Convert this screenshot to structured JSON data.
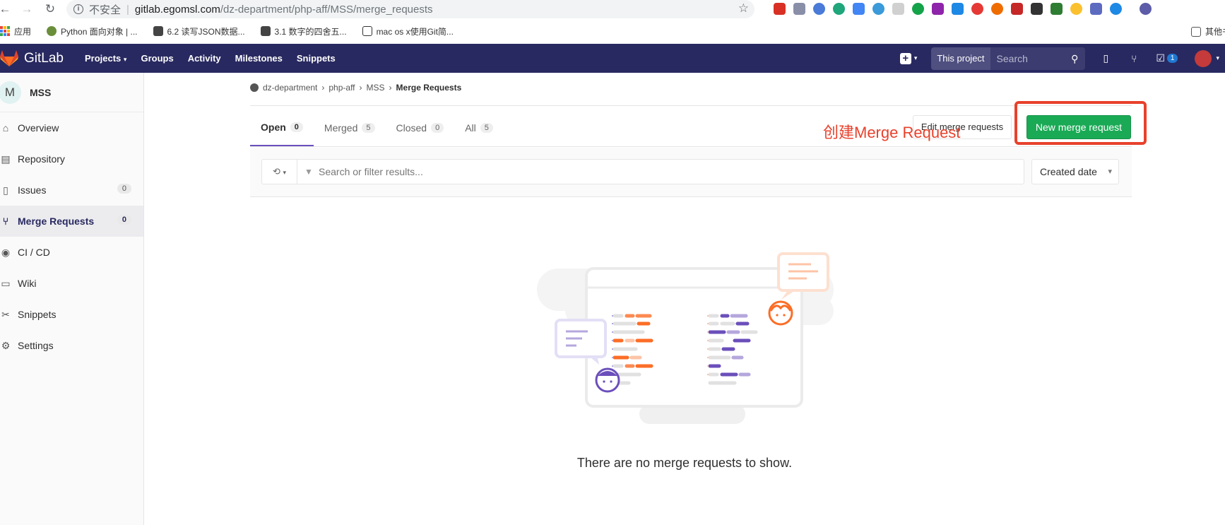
{
  "browser": {
    "insecure_label": "不安全",
    "url_host": "gitlab.egomsl.com",
    "url_path": "/dz-department/php-aff/MSS/merge_requests",
    "bookmarks": [
      "应用",
      "Python 面向对象 | ...",
      "6.2 读写JSON数据...",
      "3.1 数字的四舍五...",
      "mac os x使用Git简..."
    ],
    "other_bookmarks": "其他书签"
  },
  "header": {
    "brand": "GitLab",
    "nav": [
      "Projects",
      "Groups",
      "Activity",
      "Milestones",
      "Snippets"
    ],
    "search_scope": "This project",
    "search_placeholder": "Search",
    "todo_count": "1"
  },
  "sidebar": {
    "project_initial": "M",
    "project_name": "MSS",
    "items": [
      {
        "label": "Overview",
        "icon": "home-icon"
      },
      {
        "label": "Repository",
        "icon": "doc-icon"
      },
      {
        "label": "Issues",
        "icon": "issues-icon",
        "count": "0"
      },
      {
        "label": "Merge Requests",
        "icon": "merge-icon",
        "count": "0"
      },
      {
        "label": "CI / CD",
        "icon": "rocket-icon"
      },
      {
        "label": "Wiki",
        "icon": "book-icon"
      },
      {
        "label": "Snippets",
        "icon": "scissors-icon"
      },
      {
        "label": "Settings",
        "icon": "gear-icon"
      }
    ]
  },
  "breadcrumb": [
    "dz-department",
    "php-aff",
    "MSS",
    "Merge Requests"
  ],
  "tabs": [
    {
      "label": "Open",
      "count": "0"
    },
    {
      "label": "Merged",
      "count": "5"
    },
    {
      "label": "Closed",
      "count": "0"
    },
    {
      "label": "All",
      "count": "5"
    }
  ],
  "actions": {
    "edit_label": "Edit merge requests",
    "new_label": "New merge request",
    "annotation": "创建Merge Request"
  },
  "filter": {
    "placeholder": "Search or filter results...",
    "sort_label": "Created date"
  },
  "empty_state": "There are no merge requests to show.",
  "colors": {
    "header_bg": "#292961",
    "accent": "#6b4fbb",
    "new_button": "#1aaa55",
    "annotation_red": "#e8412c"
  }
}
